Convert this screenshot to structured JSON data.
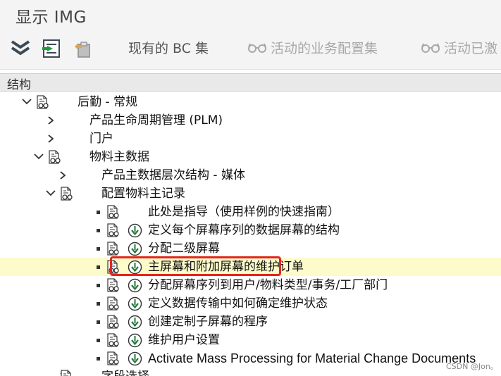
{
  "window": {
    "title": "显示 IMG"
  },
  "toolbar": {
    "buttons": [
      {
        "label": "现有的 BC 集",
        "enabled": true
      },
      {
        "label": "活动的业务配置集",
        "enabled": false,
        "icon": "glasses-icon"
      },
      {
        "label": "活动已激",
        "enabled": false,
        "icon": "glasses-icon"
      }
    ],
    "icons": [
      "expand-all-icon",
      "execute-icon",
      "clipboard-icon"
    ]
  },
  "tree": {
    "header": "结构",
    "nodes": [
      {
        "label": "后勤 - 常规",
        "level": 0,
        "state": "expanded",
        "icon": "doc-glasses-icon"
      },
      {
        "label": "产品生命周期管理 (PLM)",
        "level": 1,
        "state": "collapsed"
      },
      {
        "label": "门户",
        "level": 1,
        "state": "collapsed"
      },
      {
        "label": "物料主数据",
        "level": 1,
        "state": "expanded",
        "icon": "doc-glasses-icon"
      },
      {
        "label": "产品主数据层次结构 - 媒体",
        "level": 2,
        "state": "collapsed"
      },
      {
        "label": "配置物料主记录",
        "level": 2,
        "state": "expanded",
        "icon": "doc-glasses-icon"
      },
      {
        "label": "此处是指导（使用样例的快速指南）",
        "level": 3,
        "state": "leaf",
        "icon": "doc-glasses-icon",
        "exec": false
      },
      {
        "label": "定义每个屏幕序列的数据屏幕的结构",
        "level": 3,
        "state": "leaf",
        "icon": "doc-glasses-icon",
        "exec": true
      },
      {
        "label": "分配二级屏幕",
        "level": 3,
        "state": "leaf",
        "icon": "doc-glasses-icon",
        "exec": true
      },
      {
        "label": "主屏幕和附加屏幕的维护订单",
        "level": 3,
        "state": "leaf",
        "icon": "doc-glasses-icon",
        "exec": true,
        "selected": true
      },
      {
        "label": "分配屏幕序列到用户/物料类型/事务/工厂部门",
        "level": 3,
        "state": "leaf",
        "icon": "doc-glasses-icon",
        "exec": true
      },
      {
        "label": "定义数据传输中如何确定维护状态",
        "level": 3,
        "state": "leaf",
        "icon": "doc-glasses-icon",
        "exec": true
      },
      {
        "label": "创建定制子屏幕的程序",
        "level": 3,
        "state": "leaf",
        "icon": "doc-glasses-icon",
        "exec": true
      },
      {
        "label": "维护用户设置",
        "level": 3,
        "state": "leaf",
        "icon": "doc-glasses-icon",
        "exec": true
      },
      {
        "label": "Activate Mass Processing for Material Change Documents",
        "level": 3,
        "state": "leaf",
        "icon": "doc-glasses-icon",
        "exec": true
      },
      {
        "label": "字段选择",
        "level": 2,
        "state": "collapsed",
        "icon": "doc-glasses-icon"
      }
    ]
  },
  "colors": {
    "highlight": "#fdfbc9",
    "annotation": "#e3261e",
    "exec_green": "#1f7a3a"
  },
  "watermark": "CSDN @Jon。"
}
